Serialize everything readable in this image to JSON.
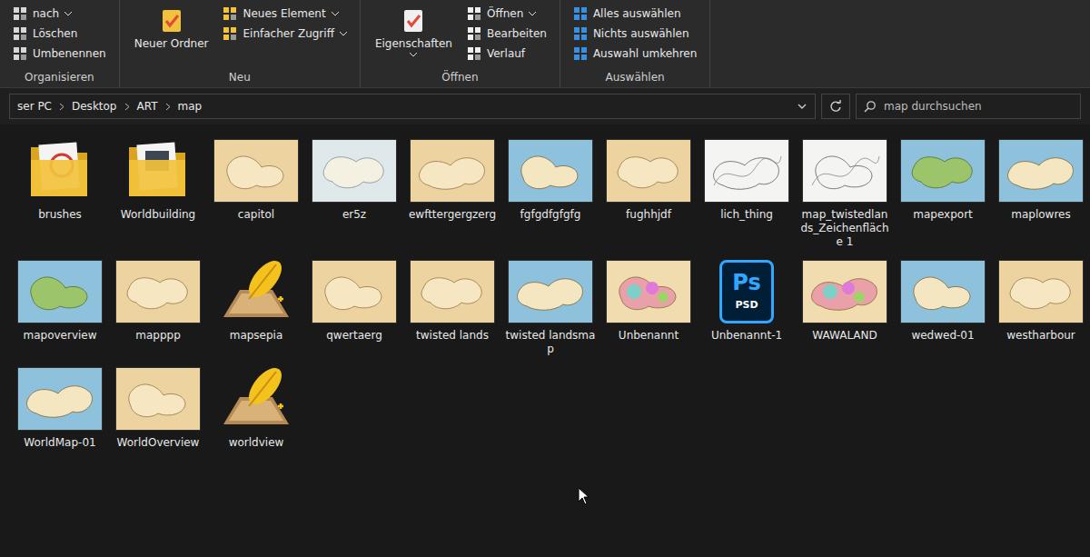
{
  "window": {
    "breadcrumb": [
      "ser PC",
      "Desktop",
      "ART",
      "map"
    ]
  },
  "ribbon": {
    "groups": [
      {
        "label": "Organisieren",
        "items": [
          {
            "label": "nach",
            "kind": "small",
            "dropdown": true
          },
          {
            "label": "Löschen",
            "kind": "small",
            "dropdown": false
          },
          {
            "label": "Umbenennen",
            "kind": "small",
            "dropdown": false
          }
        ]
      },
      {
        "label": "Neu",
        "items": [
          {
            "label": "Neuer Ordner",
            "kind": "large",
            "dropdown": false
          },
          {
            "label": "Neues Element",
            "kind": "small",
            "dropdown": true
          },
          {
            "label": "Einfacher Zugriff",
            "kind": "small",
            "dropdown": true
          }
        ]
      },
      {
        "label": "Öffnen",
        "items": [
          {
            "label": "Eigenschaften",
            "kind": "large",
            "dropdown": true
          },
          {
            "label": "Öffnen",
            "kind": "small",
            "dropdown": true
          },
          {
            "label": "Bearbeiten",
            "kind": "small",
            "dropdown": false
          },
          {
            "label": "Verlauf",
            "kind": "small",
            "dropdown": false
          }
        ]
      },
      {
        "label": "Auswählen",
        "items": [
          {
            "label": "Alles auswählen",
            "kind": "small",
            "dropdown": false
          },
          {
            "label": "Nichts auswählen",
            "kind": "small",
            "dropdown": false
          },
          {
            "label": "Auswahl umkehren",
            "kind": "small",
            "dropdown": false
          }
        ]
      }
    ]
  },
  "search": {
    "placeholder": "map durchsuchen"
  },
  "files": [
    {
      "name": "brushes",
      "kind": "folder"
    },
    {
      "name": "Worldbuilding",
      "kind": "folder"
    },
    {
      "name": "capitol",
      "kind": "sepia"
    },
    {
      "name": "er5z",
      "kind": "pale"
    },
    {
      "name": "ewfttergergzerg",
      "kind": "sepia"
    },
    {
      "name": "fgfgdfgfgfg",
      "kind": "ocean"
    },
    {
      "name": "fughhjdf",
      "kind": "sepia"
    },
    {
      "name": "lich_thing",
      "kind": "sketch"
    },
    {
      "name": "map_twistedlands_Zeichenfläche 1",
      "kind": "sketch"
    },
    {
      "name": "mapexport",
      "kind": "green"
    },
    {
      "name": "maplowres",
      "kind": "ocean"
    },
    {
      "name": "mapoverview",
      "kind": "green"
    },
    {
      "name": "mapppp",
      "kind": "sepia"
    },
    {
      "name": "mapsepia",
      "kind": "feather"
    },
    {
      "name": "qwertaerg",
      "kind": "sepia"
    },
    {
      "name": "twisted lands",
      "kind": "sepia"
    },
    {
      "name": "twisted landsmap",
      "kind": "ocean"
    },
    {
      "name": "Unbenannt",
      "kind": "political"
    },
    {
      "name": "Unbenannt-1",
      "kind": "psd",
      "badge": "Ps",
      "ext": "PSD"
    },
    {
      "name": "WAWALAND",
      "kind": "political"
    },
    {
      "name": "wedwed-01",
      "kind": "ocean"
    },
    {
      "name": "westharbour",
      "kind": "sepia"
    },
    {
      "name": "WorldMap-01",
      "kind": "ocean"
    },
    {
      "name": "WorldOverview",
      "kind": "sepia"
    },
    {
      "name": "worldview",
      "kind": "feather"
    }
  ]
}
